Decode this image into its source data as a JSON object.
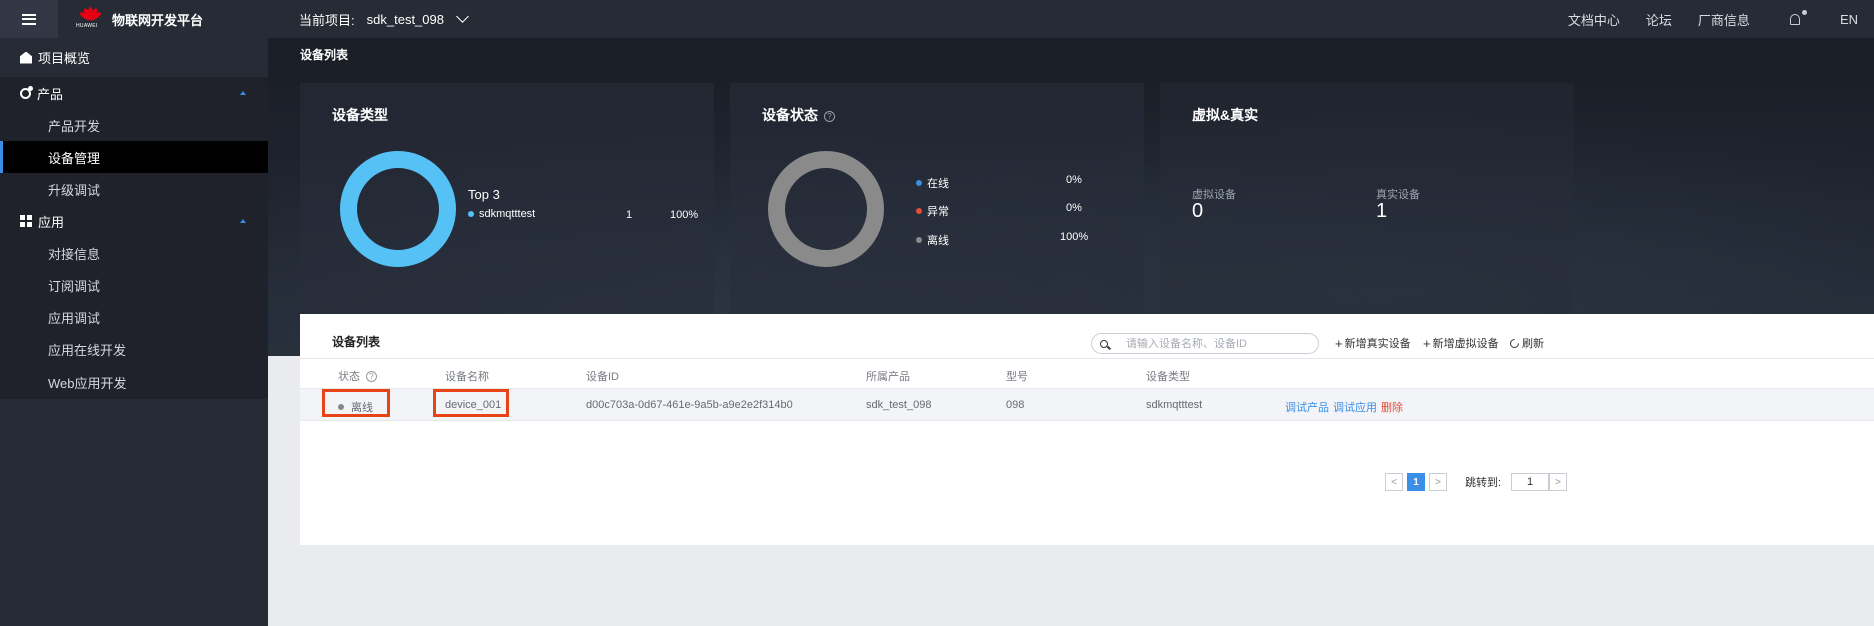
{
  "header": {
    "brand_logo_text": "HUAWEI",
    "brand_title": "物联网开发平台",
    "project_label": "当前项目:",
    "project_name": "sdk_test_098",
    "links": [
      "文档中心",
      "论坛",
      "厂商信息"
    ],
    "lang": "EN",
    "icons": [
      "menu-icon",
      "bell-icon",
      "chevron-down-icon"
    ]
  },
  "sidebar": {
    "overview": "项目概览",
    "product": "产品",
    "product_items": [
      "产品开发",
      "设备管理",
      "升级调试"
    ],
    "app": "应用",
    "app_items": [
      "对接信息",
      "订阅调试",
      "应用调试",
      "应用在线开发",
      "Web应用开发"
    ],
    "active": "设备管理"
  },
  "hero": {
    "title": "设备列表",
    "type_card": {
      "title": "设备类型",
      "top_label": "Top 3",
      "item_name": "sdkmqtttest",
      "item_count": "1",
      "item_pct": "100%",
      "color": "#55c1f5"
    },
    "status_card": {
      "title": "设备状态",
      "online": "在线",
      "online_pct": "0%",
      "error": "异常",
      "error_pct": "0%",
      "offline": "离线",
      "offline_pct": "100%",
      "colors": {
        "online": "#3a8ee6",
        "error": "#e64b3b",
        "offline": "#8a8a8a"
      }
    },
    "virtual_card": {
      "title": "虚拟&真实",
      "virtual_label": "虚拟设备",
      "virtual_count": "0",
      "real_label": "真实设备",
      "real_count": "1"
    }
  },
  "table": {
    "title": "设备列表",
    "search_placeholder": "请输入设备名称、设备ID",
    "add_real": "新增真实设备",
    "add_virtual": "新增虚拟设备",
    "refresh": "刷新",
    "columns": [
      "状态",
      "设备名称",
      "设备ID",
      "所属产品",
      "型号",
      "设备类型"
    ],
    "rows": [
      {
        "status": "离线",
        "name": "device_001",
        "id": "d00c703a-0d67-461e-9a5b-a9e2e2f314b0",
        "product": "sdk_test_098",
        "model": "098",
        "type": "sdkmqtttest",
        "ops": [
          "调试产品",
          "调试应用",
          "删除"
        ]
      }
    ],
    "pager": {
      "prev": "<",
      "current": "1",
      "next": ">",
      "jump_label": "跳转到:",
      "jump_value": "1",
      "go": ">"
    }
  }
}
